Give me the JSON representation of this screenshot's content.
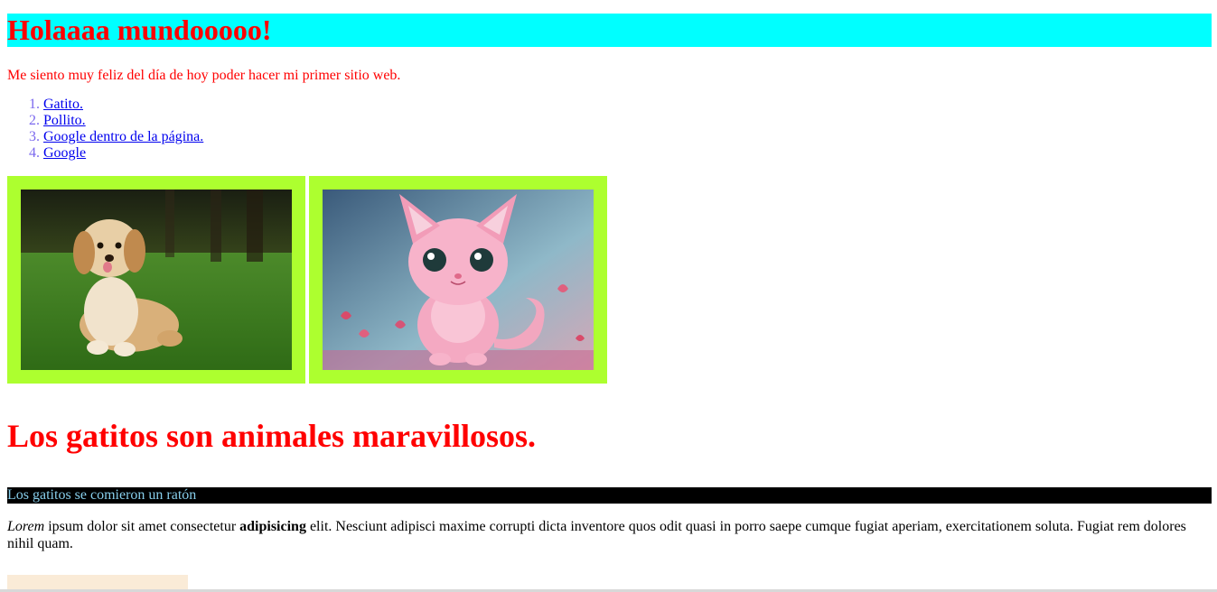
{
  "header": {
    "title": "Holaaaa mundooooo!"
  },
  "intro": {
    "text": "Me siento muy feliz del día de hoy poder hacer mi primer sitio web."
  },
  "links": [
    {
      "label": "Gatito."
    },
    {
      "label": "Pollito."
    },
    {
      "label": "Google dentro de la página."
    },
    {
      "label": "Google"
    }
  ],
  "gallery": {
    "images": [
      {
        "name": "puppy-on-grass"
      },
      {
        "name": "pink-kitten"
      }
    ],
    "frame_color": "#adff2f"
  },
  "section": {
    "title": "Los gatitos son animales maravillosos.",
    "bar_text": "Los gatitos se comieron un ratón",
    "paragraph": {
      "em": "Lorem",
      "part1": " ipsum dolor sit amet consectetur ",
      "strong": "adipisicing",
      "part2": " elit. Nesciunt adipisci maxime corrupti dicta inventore quos odit quasi in porro saepe cumque fugiat aperiam, exercitationem soluta. Fugiat rem dolores nihil quam."
    }
  },
  "colors": {
    "title_bg": "#00ffff",
    "accent_red": "#ff0000",
    "bar_bg": "#000000",
    "bar_text": "#87ceeb",
    "peach": "#faebd7"
  }
}
